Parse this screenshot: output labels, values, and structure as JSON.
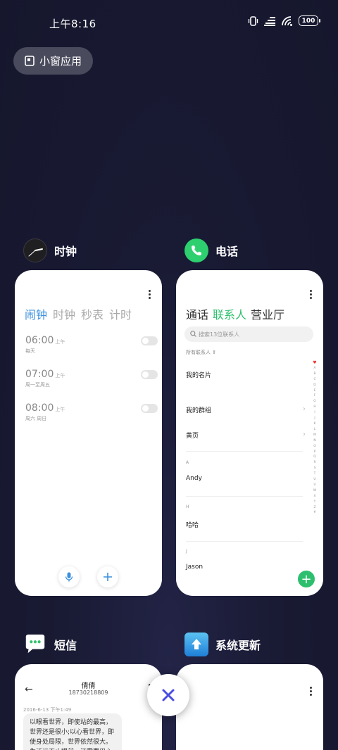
{
  "status": {
    "time": "上午8:16",
    "battery": "100"
  },
  "float_window": {
    "label": "小窗应用"
  },
  "apps": {
    "clock": {
      "name": "时钟",
      "tabs": [
        "闹钟",
        "时钟",
        "秒表",
        "计时"
      ],
      "active_tab": 0,
      "alarms": [
        {
          "time": "06:00",
          "ampm": "上午",
          "days": "每天"
        },
        {
          "time": "07:00",
          "ampm": "上午",
          "days": "周一至周五"
        },
        {
          "time": "08:00",
          "ampm": "上午",
          "days": "周六 周日"
        }
      ]
    },
    "phone": {
      "name": "电话",
      "tabs": [
        "通话",
        "联系人",
        "营业厅"
      ],
      "active_tab": 1,
      "search_placeholder": "搜索13位联系人",
      "filter": "所有联系人 ⇕",
      "rows": {
        "card": "我的名片",
        "groups": "我的群组",
        "yellow": "黄页"
      },
      "sections": [
        {
          "letter": "A",
          "name": "Andy"
        },
        {
          "letter": "H",
          "name": "哈哈"
        },
        {
          "letter": "J",
          "name": "Jason"
        }
      ],
      "alpha_index": [
        "♥",
        "A",
        "B",
        "C",
        "D",
        "E",
        "F",
        "G",
        "H",
        "I",
        "J",
        "K",
        "L",
        "M",
        "N",
        "O",
        "P",
        "Q",
        "R",
        "S",
        "T",
        "U",
        "V",
        "W",
        "X",
        "Y",
        "Z",
        "#"
      ]
    },
    "sms": {
      "name": "短信",
      "contact": "倩倩",
      "number": "18730218809",
      "date": "2016-6-13 下午1:49",
      "message": "以眼看世界，即使站的最高，世界还是很小;以心看世界，即使身处局限，世界依然很大。生活远不止眼前，还需要用心去体会不同的"
    },
    "update": {
      "name": "系统更新"
    }
  },
  "colors": {
    "clock_accent": "#3b8fdd",
    "phone_accent": "#2dbf6d",
    "close_accent": "#4a4de0"
  }
}
